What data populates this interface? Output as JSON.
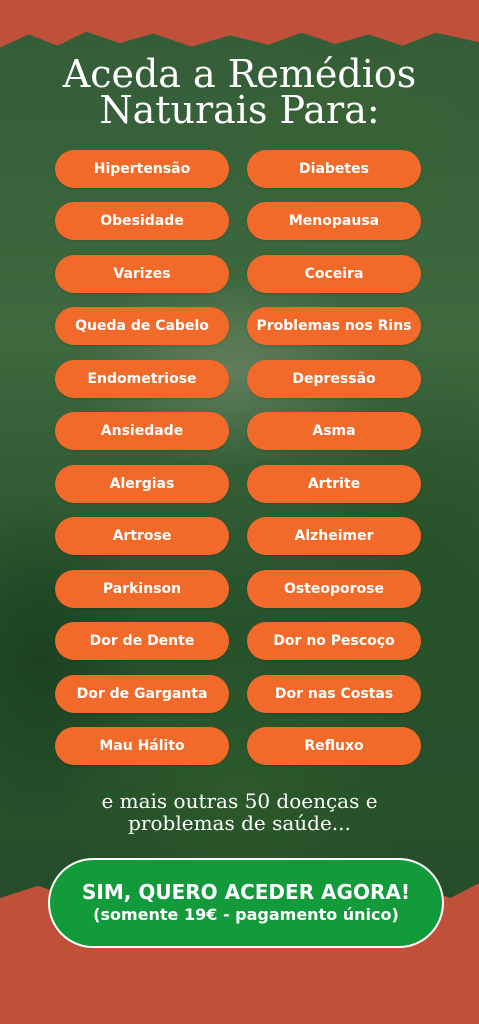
{
  "title": {
    "line1": "Aceda a Remédios",
    "line2": "Naturais Para:"
  },
  "conditions_left": [
    "Hipertensão",
    "Obesidade",
    "Varizes",
    "Queda de Cabelo",
    "Endometriose",
    "Ansiedade",
    "Alergias",
    "Artrose",
    "Parkinson",
    "Dor de Dente",
    "Dor de Garganta",
    "Mau Hálito"
  ],
  "conditions_right": [
    "Diabetes",
    "Menopausa",
    "Coceira",
    "Problemas nos Rins",
    "Depressão",
    "Asma",
    "Artrite",
    "Alzheimer",
    "Osteoporose",
    "Dor no Pescoço",
    "Dor nas Costas",
    "Refluxo"
  ],
  "footnote": {
    "line1": "e mais outras 50 doenças e",
    "line2": "problemas de saúde..."
  },
  "cta": {
    "main_label": "SIM, QUERO ACEDER AGORA!",
    "sub_label": "(somente 19€ - pagamento único)"
  },
  "colors": {
    "brand_red": "#c1503b",
    "pill_orange": "#f26a2a",
    "cta_green": "#129a3b"
  }
}
